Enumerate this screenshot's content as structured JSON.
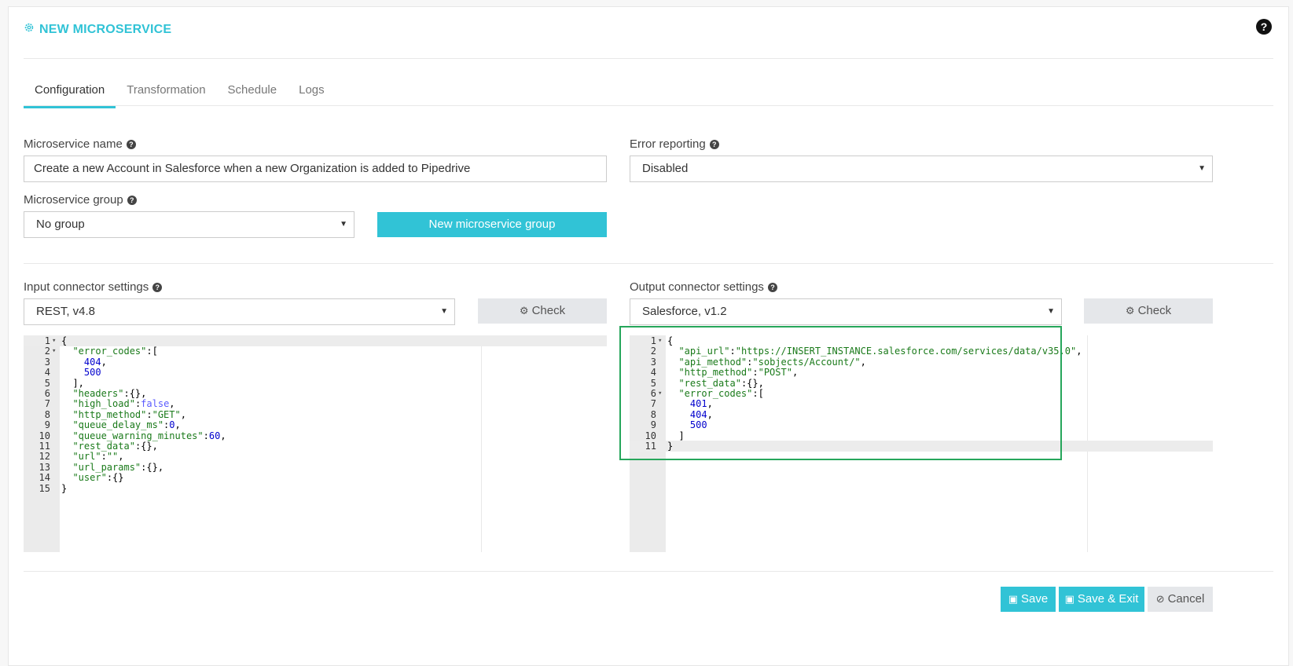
{
  "header": {
    "title": "NEW MICROSERVICE",
    "help": "?"
  },
  "tabs": [
    {
      "label": "Configuration",
      "active": true
    },
    {
      "label": "Transformation",
      "active": false
    },
    {
      "label": "Schedule",
      "active": false
    },
    {
      "label": "Logs",
      "active": false
    }
  ],
  "form": {
    "name_label": "Microservice name",
    "name_value": "Create a new Account in Salesforce when a new Organization is added to Pipedrive",
    "error_label": "Error reporting",
    "error_value": "Disabled",
    "group_label": "Microservice group",
    "group_value": "No group",
    "new_group_button": "New microservice group",
    "input_label": "Input connector settings",
    "input_value": "REST, v4.8",
    "output_label": "Output connector settings",
    "output_value": "Salesforce, v1.2",
    "check_label": "Check"
  },
  "input_editor": {
    "lines": [
      "{",
      "  \"error_codes\":[",
      "    404,",
      "    500",
      "  ],",
      "  \"headers\":{},",
      "  \"high_load\":false,",
      "  \"http_method\":\"GET\",",
      "  \"queue_delay_ms\":0,",
      "  \"queue_warning_minutes\":60,",
      "  \"rest_data\":{},",
      "  \"url\":\"\",",
      "  \"url_params\":{},",
      "  \"user\":{}",
      "}"
    ],
    "folds": [
      1,
      2
    ]
  },
  "output_editor": {
    "lines": [
      "{",
      "  \"api_url\":\"https://INSERT_INSTANCE.salesforce.com/services/data/v35.0\",",
      "  \"api_method\":\"sobjects/Account/\",",
      "  \"http_method\":\"POST\",",
      "  \"rest_data\":{},",
      "  \"error_codes\":[",
      "    401,",
      "    404,",
      "    500",
      "  ]",
      "}"
    ],
    "folds": [
      1,
      6
    ],
    "active_line": 11
  },
  "footer": {
    "save": "Save",
    "save_exit": "Save & Exit",
    "cancel": "Cancel"
  },
  "colors": {
    "accent": "#31c3d6",
    "highlight": "#26a65b"
  }
}
